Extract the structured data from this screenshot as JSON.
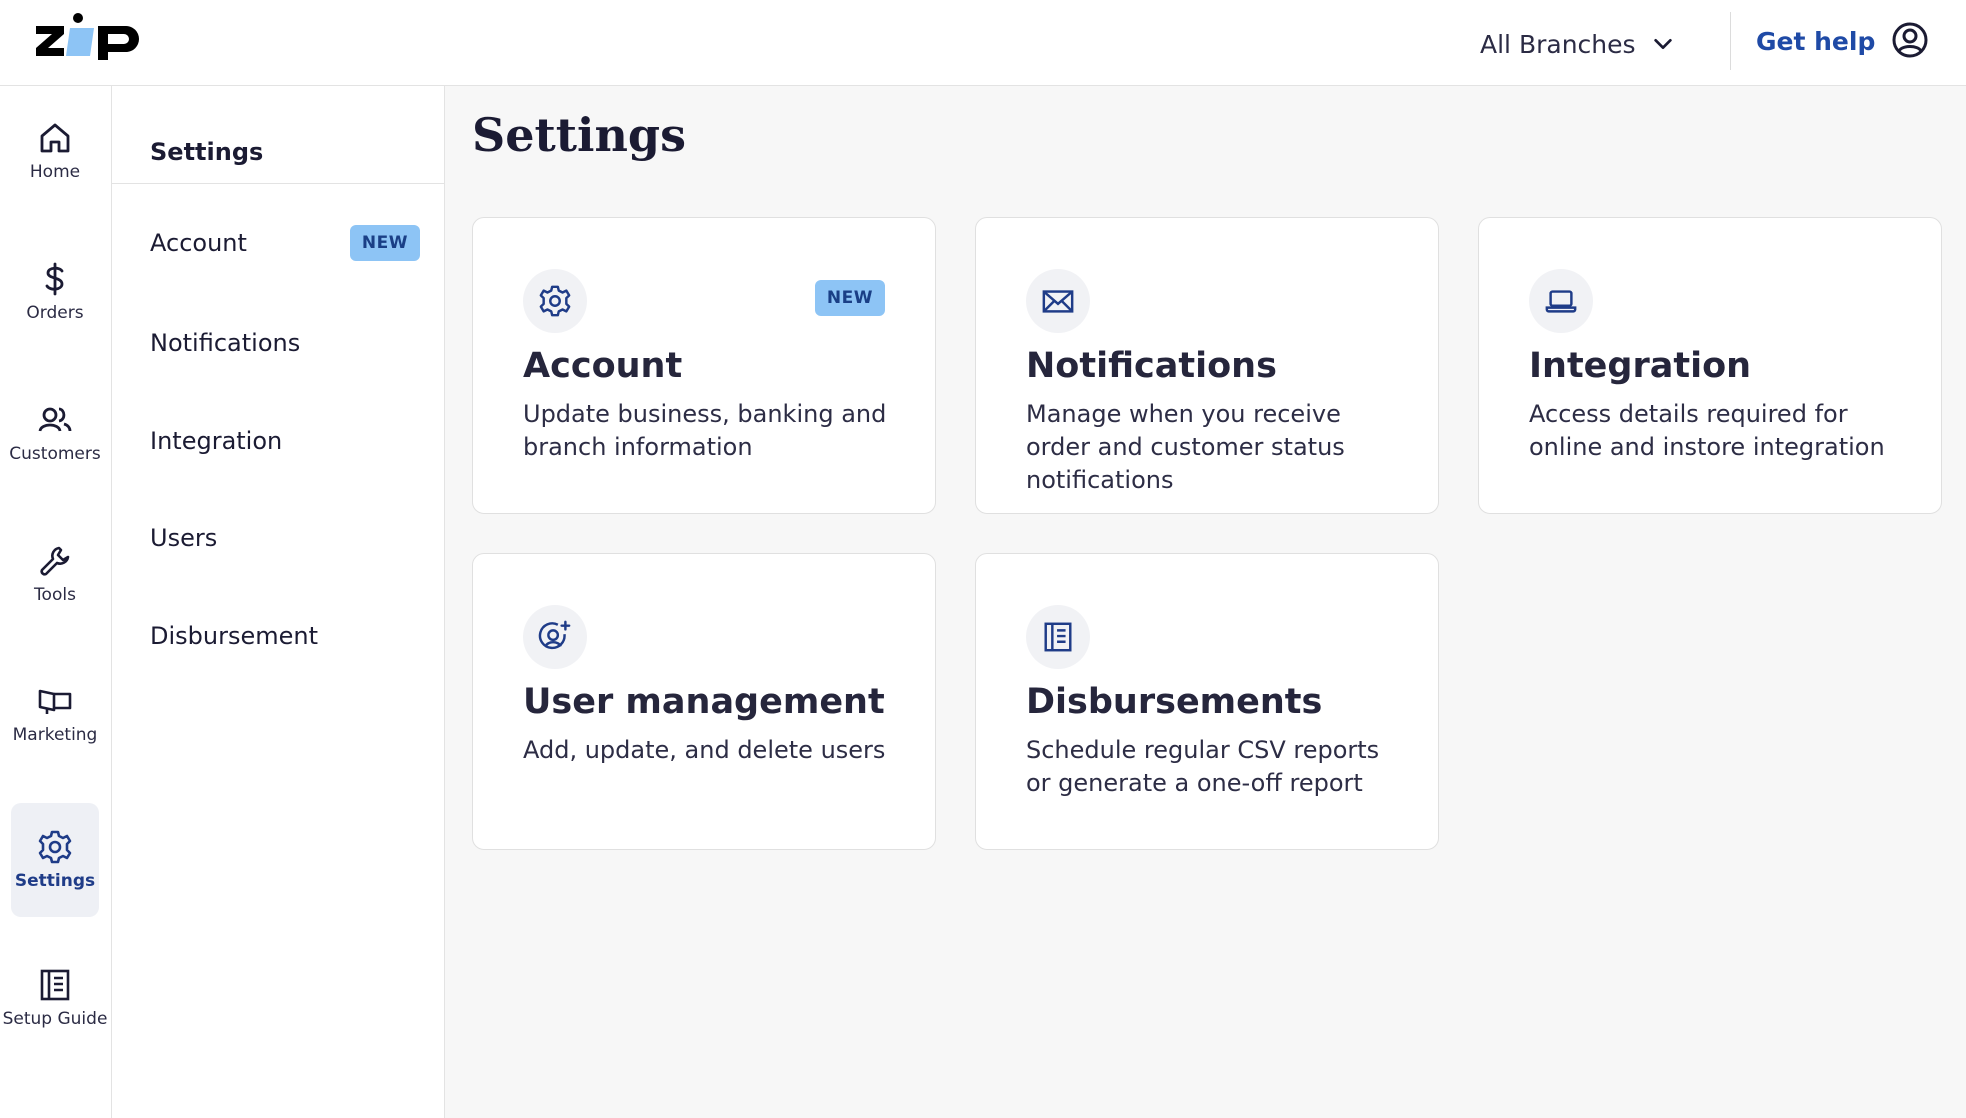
{
  "brand": {
    "logo_text": "zip",
    "accent": "#8dc4f5",
    "ink": "#1b1b33",
    "link": "#1f4aa6"
  },
  "header": {
    "branch_select": "All Branches",
    "get_help": "Get help"
  },
  "rail": {
    "items": [
      {
        "label": "Home",
        "icon": "home-icon"
      },
      {
        "label": "Orders",
        "icon": "dollar-icon"
      },
      {
        "label": "Customers",
        "icon": "users-icon"
      },
      {
        "label": "Tools",
        "icon": "wrench-icon"
      },
      {
        "label": "Marketing",
        "icon": "billboard-icon"
      },
      {
        "label": "Settings",
        "icon": "gear-icon",
        "active": true
      },
      {
        "label": "Setup Guide",
        "icon": "guide-icon"
      }
    ]
  },
  "subnav": {
    "title": "Settings",
    "items": [
      {
        "label": "Account",
        "badge": "NEW"
      },
      {
        "label": "Notifications"
      },
      {
        "label": "Integration"
      },
      {
        "label": "Users"
      },
      {
        "label": "Disbursement"
      }
    ]
  },
  "main": {
    "title": "Settings",
    "cards": [
      {
        "title": "Account",
        "desc": "Update business, banking and branch information",
        "badge": "NEW",
        "icon": "gear-icon"
      },
      {
        "title": "Notifications",
        "desc": "Manage when you receive order and customer status notifications",
        "icon": "envelope-icon"
      },
      {
        "title": "Integration",
        "desc": "Access details required for online and instore integration",
        "icon": "laptop-icon"
      },
      {
        "title": "User management",
        "desc": "Add, update, and delete users",
        "icon": "user-add-icon"
      },
      {
        "title": "Disbursements",
        "desc": "Schedule regular CSV reports or generate a one-off report",
        "icon": "report-icon"
      }
    ]
  }
}
